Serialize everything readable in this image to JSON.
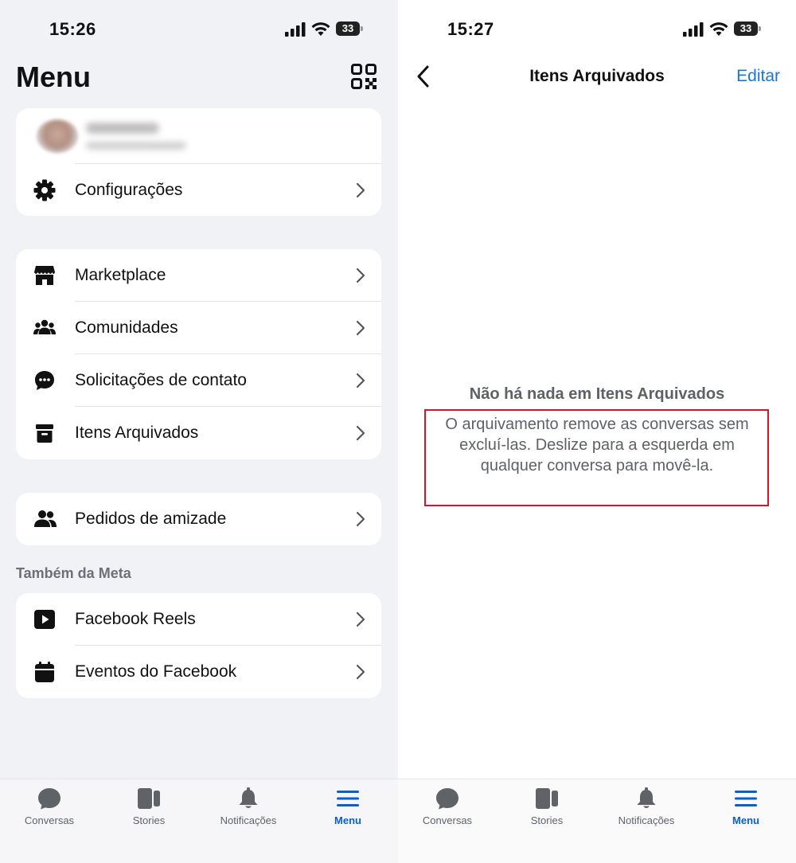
{
  "left": {
    "status": {
      "time": "15:26",
      "battery": "33"
    },
    "title": "Menu",
    "settings_label": "Configurações",
    "group1": [
      {
        "label": "Marketplace",
        "icon": "store-icon"
      },
      {
        "label": "Comunidades",
        "icon": "people-group-icon"
      },
      {
        "label": "Solicitações de contato",
        "icon": "chat-bubble-icon"
      },
      {
        "label": "Itens Arquivados",
        "icon": "archive-box-icon"
      }
    ],
    "friend_requests_label": "Pedidos de amizade",
    "section_label": "Também da Meta",
    "meta_items": [
      {
        "label": "Facebook Reels",
        "icon": "play-square-icon"
      },
      {
        "label": "Eventos do Facebook",
        "icon": "calendar-icon"
      }
    ]
  },
  "right": {
    "status": {
      "time": "15:27",
      "battery": "33"
    },
    "nav": {
      "title": "Itens Arquivados",
      "edit": "Editar"
    },
    "empty": {
      "title": "Não há nada em Itens Arquivados",
      "body": "O arquivamento remove as conversas sem excluí-las. Deslize para a esquerda em qualquer conversa para movê-la."
    }
  },
  "tabs": [
    {
      "label": "Conversas",
      "icon": "chat-bubble-icon"
    },
    {
      "label": "Stories",
      "icon": "stories-icon"
    },
    {
      "label": "Notificações",
      "icon": "bell-icon"
    },
    {
      "label": "Menu",
      "icon": "hamburger-icon",
      "active": true
    }
  ],
  "colors": {
    "accent": "#0a5fcf",
    "link": "#1877d6",
    "highlight_border": "#d9112a",
    "background": "#f1f2f6"
  }
}
